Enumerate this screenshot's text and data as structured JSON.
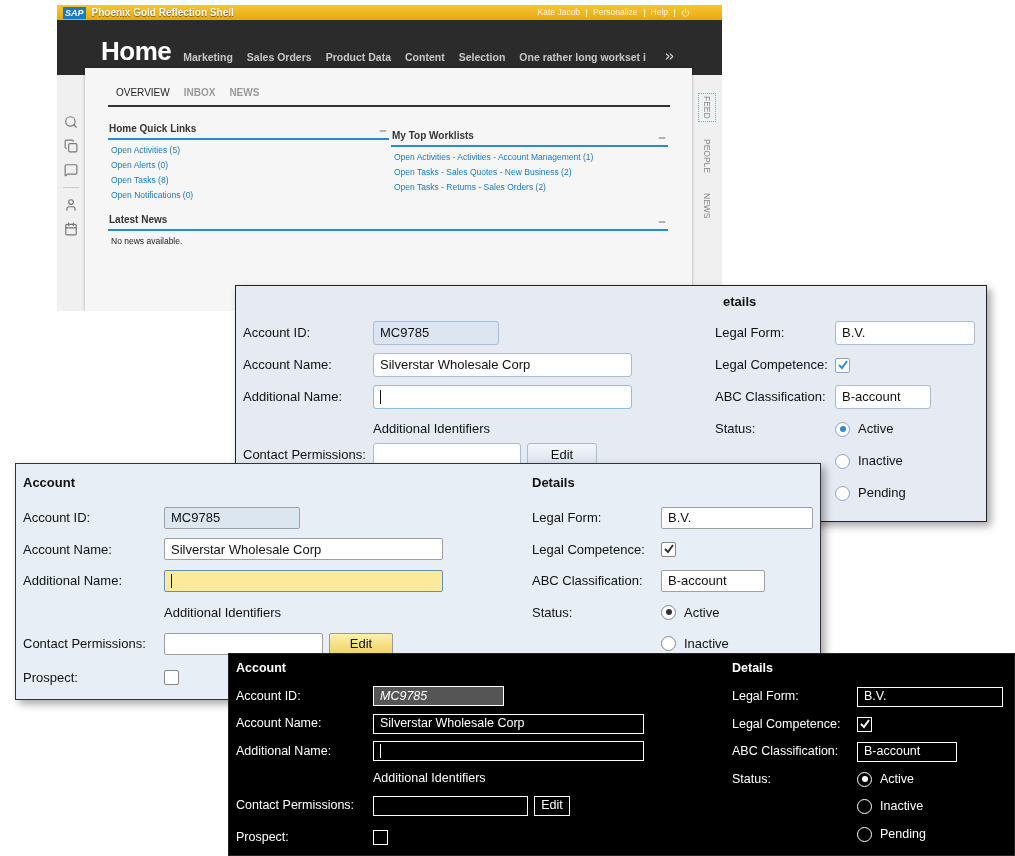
{
  "shell": {
    "brand": "SAP",
    "title": "Phoenix Gold Reflection Shell",
    "user_links": [
      "Kate Jacob",
      "Personalize",
      "Help"
    ],
    "page_title": "Home",
    "worksets": [
      "Marketing",
      "Sales Orders",
      "Product Data",
      "Content",
      "Selection",
      "One rather long workset i"
    ],
    "tabs": [
      {
        "label": "OVERVIEW",
        "selected": true
      },
      {
        "label": "INBOX",
        "selected": false
      },
      {
        "label": "NEWS",
        "selected": false
      }
    ],
    "quick_links": {
      "title": "Home Quick Links",
      "links": [
        "Open Activities (5)",
        "Open Alerts (0)",
        "Open Tasks (8)",
        "Open Notifications (0)"
      ]
    },
    "worklists": {
      "title": "My Top Worklists",
      "links": [
        "Open Activities - Activities - Account Management (1)",
        "Open Tasks - Sales Quotes - New Business (2)",
        "Open Tasks - Returns - Sales Orders (2)"
      ]
    },
    "news": {
      "title": "Latest News",
      "text": "No news available."
    },
    "side_tabs": [
      {
        "label": "FEED",
        "selected": true
      },
      {
        "label": "PEOPLE",
        "selected": false
      },
      {
        "label": "NEWS",
        "selected": false
      }
    ]
  },
  "forms": [
    {
      "kind": "blue",
      "details_title": "etails",
      "fields": [
        {
          "label": "Account ID:",
          "value": "MC9785",
          "kind": "readonly",
          "focused": false
        },
        {
          "label": "Account Name:",
          "value": "Silverstar Wholesale Corp",
          "kind": "text",
          "focused": false
        },
        {
          "label": "Additional Name:",
          "kind": "text",
          "focused": true
        }
      ],
      "identifiers": "Additional Identifiers",
      "permissions": {
        "label": "Contact Permissions:",
        "button": "Edit"
      },
      "details": [
        {
          "label": "Legal Form:",
          "kind": "field",
          "value": "B.V."
        },
        {
          "label": "Legal Competence:",
          "kind": "checkbox",
          "checked": true
        },
        {
          "label": "ABC Classification:",
          "kind": "field",
          "value": "B-account"
        }
      ],
      "status": {
        "label": "Status:",
        "options": [
          {
            "label": "Active",
            "selected": true
          },
          {
            "label": "Inactive",
            "selected": false
          },
          {
            "label": "Pending",
            "selected": false
          }
        ]
      }
    },
    {
      "kind": "gold",
      "account_title": "Account",
      "details_title": "Details",
      "fields": [
        {
          "label": "Account ID:",
          "value": "MC9785",
          "kind": "readonly",
          "focused": false
        },
        {
          "label": "Account Name:",
          "value": "Silverstar Wholesale Corp",
          "kind": "text",
          "focused": false
        },
        {
          "label": "Additional Name:",
          "kind": "text",
          "focused": true
        }
      ],
      "identifiers": "Additional Identifiers",
      "permissions": {
        "label": "Contact Permissions:",
        "button": "Edit"
      },
      "prospect": {
        "label": "Prospect:",
        "checked": false
      },
      "details": [
        {
          "label": "Legal Form:",
          "kind": "field",
          "value": "B.V."
        },
        {
          "label": "Legal Competence:",
          "kind": "checkbox",
          "checked": true
        },
        {
          "label": "ABC Classification:",
          "kind": "field",
          "value": "B-account"
        }
      ],
      "status": {
        "label": "Status:",
        "options": [
          {
            "label": "Active",
            "selected": true
          },
          {
            "label": "Inactive",
            "selected": false
          }
        ]
      }
    },
    {
      "kind": "black",
      "account_title": "Account",
      "details_title": "Details",
      "fields": [
        {
          "label": "Account ID:",
          "value": "MC9785",
          "kind": "readonly",
          "focused": false
        },
        {
          "label": "Account Name:",
          "value": "Silverstar Wholesale Corp",
          "kind": "text",
          "focused": false
        },
        {
          "label": "Additional Name:",
          "kind": "text",
          "focused": true
        }
      ],
      "identifiers": "Additional Identifiers",
      "permissions": {
        "label": "Contact Permissions:",
        "button": "Edit"
      },
      "prospect": {
        "label": "Prospect:",
        "checked": false
      },
      "details": [
        {
          "label": "Legal Form:",
          "kind": "field",
          "value": "B.V."
        },
        {
          "label": "Legal Competence:",
          "kind": "checkbox",
          "checked": true
        },
        {
          "label": "ABC Classification:",
          "kind": "field",
          "value": "B-account"
        }
      ],
      "status": {
        "label": "Status:",
        "options": [
          {
            "label": "Active",
            "selected": true
          },
          {
            "label": "Inactive",
            "selected": false
          },
          {
            "label": "Pending",
            "selected": false
          }
        ]
      }
    }
  ]
}
